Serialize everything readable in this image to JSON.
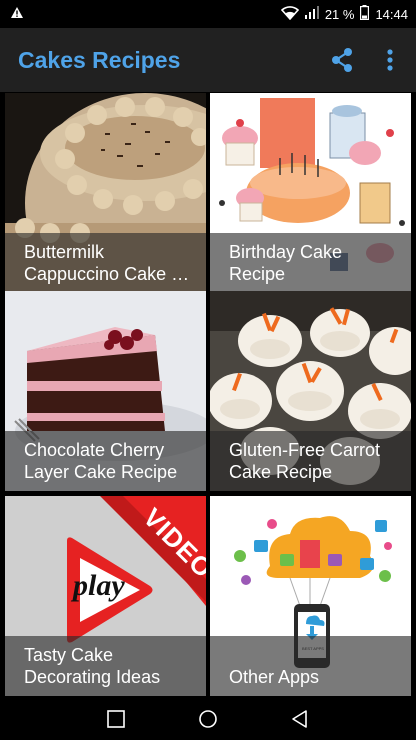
{
  "status": {
    "battery": "21 %",
    "time": "14:44"
  },
  "app": {
    "title": "Cakes Recipes"
  },
  "tiles": [
    {
      "label": "Buttermilk\nCappuccino Cake …"
    },
    {
      "label": "Birthday Cake\nRecipe"
    },
    {
      "label": "Chocolate Cherry\nLayer Cake Recipe"
    },
    {
      "label": "Gluten-Free Carrot\nCake Recipe"
    },
    {
      "label": "Tasty Cake\nDecorating Ideas",
      "badge": "VIDEO",
      "play": "play"
    },
    {
      "label": "Other Apps",
      "phone_text": "BEST APPS"
    }
  ],
  "colors": {
    "appbar": "#212121",
    "title": "#4fa3e8",
    "accent": "#ffffff"
  }
}
